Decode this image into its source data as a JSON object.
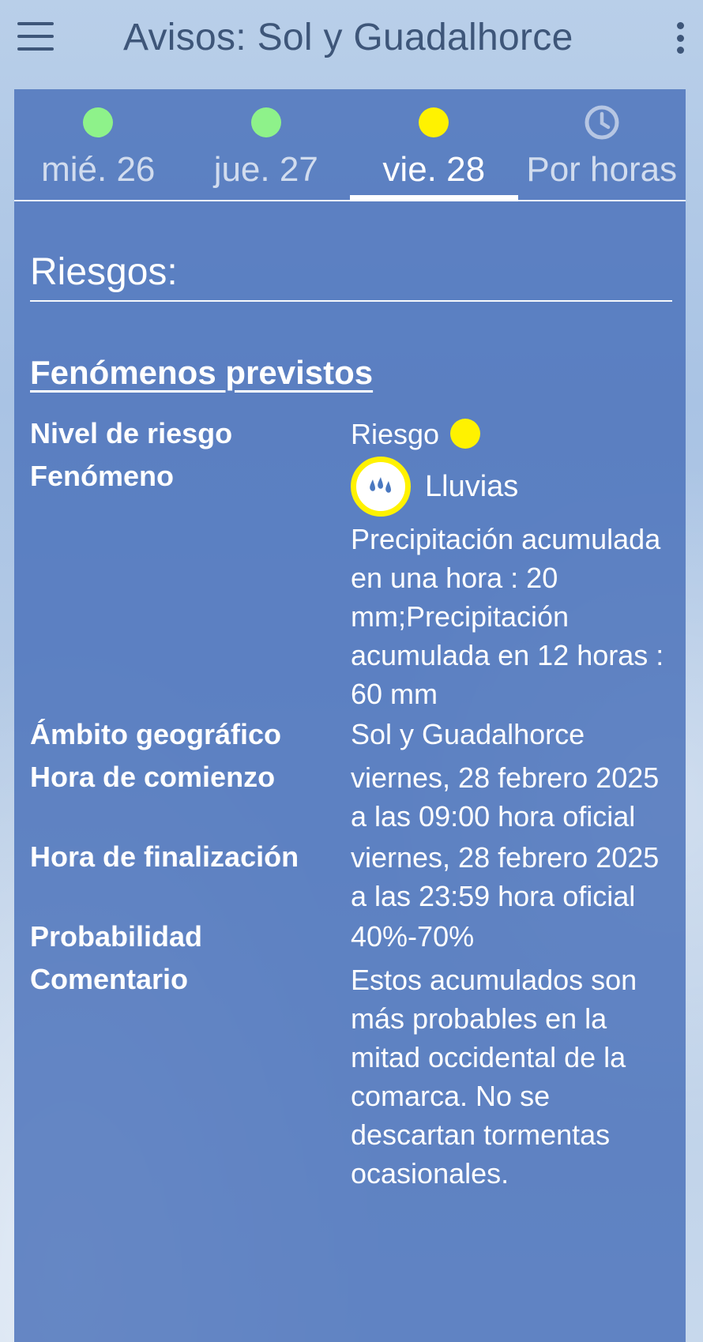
{
  "appbar": {
    "title": "Avisos: Sol y Guadalhorce",
    "menu_icon": "hamburger-menu-icon",
    "overflow_icon": "more-vert-icon"
  },
  "tabs": [
    {
      "label": "mié. 26",
      "indicator_color": "#8ef28a",
      "active": false
    },
    {
      "label": "jue. 27",
      "indicator_color": "#8ef28a",
      "active": false
    },
    {
      "label": "vie. 28",
      "indicator_color": "#fff200",
      "active": true
    },
    {
      "label": "Por horas",
      "icon": "clock-icon",
      "active": false
    }
  ],
  "section": {
    "title": "Riesgos:",
    "subtitle": "Fenómenos previstos"
  },
  "details": {
    "nivel_key": "Nivel de riesgo",
    "nivel_val": "Riesgo",
    "nivel_color": "#fff200",
    "fenomeno_key": "Fenómeno",
    "fenomeno_val": "Lluvias",
    "fenomeno_icon": "rain-drops-icon",
    "fenomeno_desc": "Precipitación acumulada en una hora : 20 mm;Precipitación acumulada en 12 horas : 60 mm",
    "ambito_key": "Ámbito geográfico",
    "ambito_val": "Sol y Guadalhorce",
    "comienzo_key": "Hora de comienzo",
    "comienzo_val": "viernes, 28 febrero 2025 a las 09:00 hora oficial",
    "fin_key": "Hora de finalización",
    "fin_val": "viernes, 28 febrero 2025 a las 23:59 hora oficial",
    "prob_key": "Probabilidad",
    "prob_val": "40%-70%",
    "coment_key": "Comentario",
    "coment_val": "Estos acumulados son más probables en la mitad occidental de la comarca. No se descartan tormentas ocasionales."
  },
  "colors": {
    "panel": "#4970b9",
    "appbar_text": "#3e5679",
    "green": "#8ef28a",
    "yellow": "#fff200"
  }
}
